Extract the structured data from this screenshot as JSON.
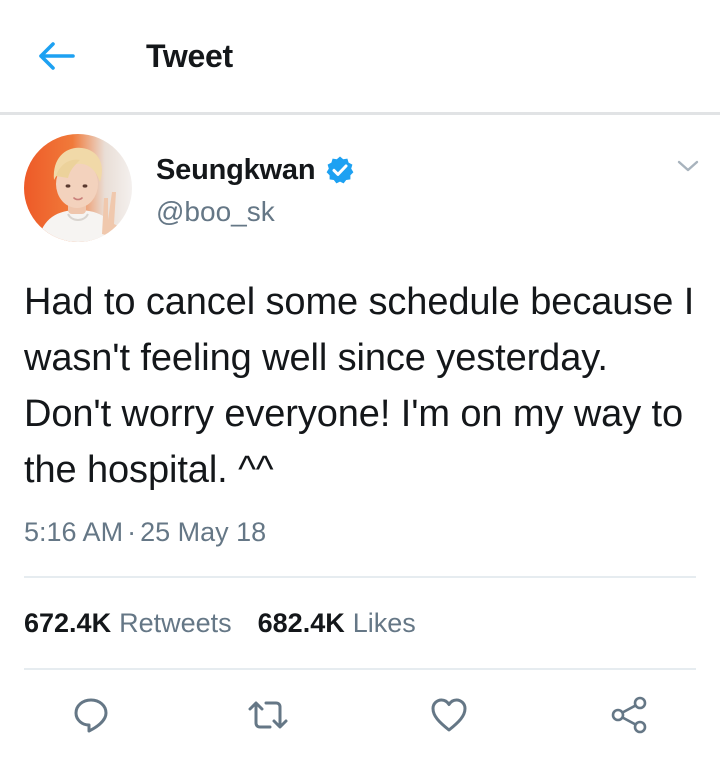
{
  "header": {
    "title": "Tweet"
  },
  "tweet": {
    "author": {
      "display_name": "Seungkwan",
      "handle": "@boo_sk",
      "verified": true
    },
    "text": "Had to cancel some schedule because I wasn't feeling well since yesterday. Don't worry everyone! I'm on my way to the hospital. ^^",
    "time": "5:16 AM",
    "separator": "·",
    "date": "25 May 18",
    "stats": {
      "retweets_count": "672.4K",
      "retweets_label": "Retweets",
      "likes_count": "682.4K",
      "likes_label": "Likes"
    }
  },
  "icons": {
    "back": "arrow-left-icon",
    "verified": "verified-badge-icon",
    "caret": "chevron-down-icon",
    "reply": "reply-bubble-icon",
    "retweet": "retweet-icon",
    "like": "heart-icon",
    "share": "share-icon"
  },
  "colors": {
    "accent": "#1da1f2",
    "text_primary": "#14171a",
    "text_secondary": "#657786",
    "divider": "#e6ecf0",
    "icon_gray": "#657786"
  }
}
